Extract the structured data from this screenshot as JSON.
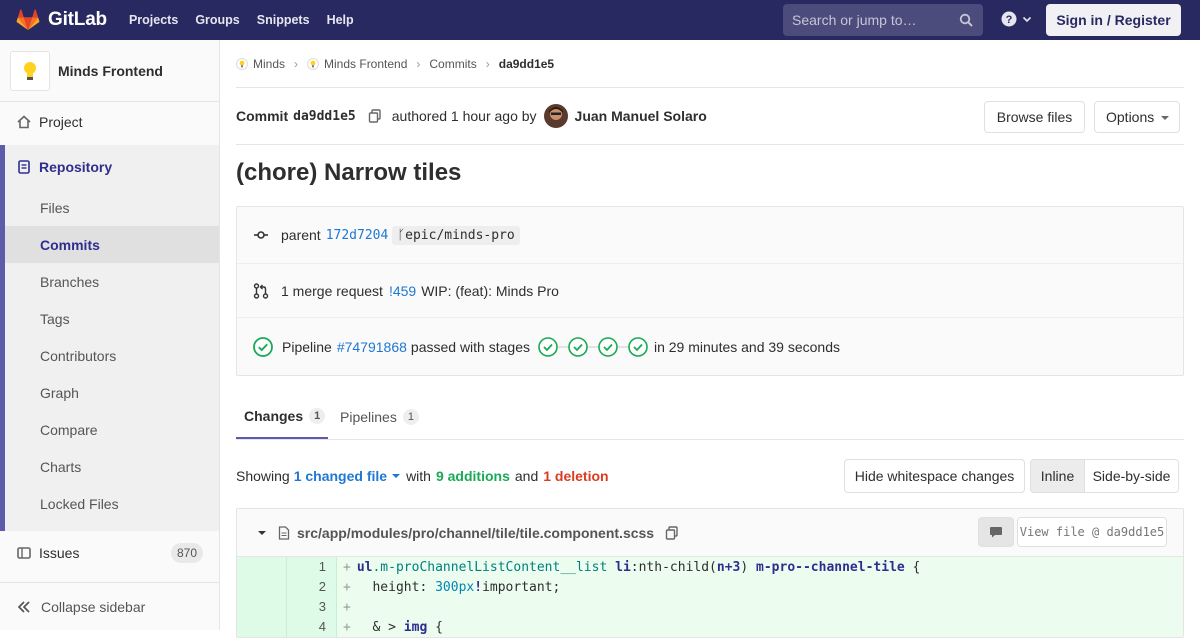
{
  "topnav": {
    "brand": "GitLab",
    "links": [
      "Projects",
      "Groups",
      "Snippets",
      "Help"
    ],
    "search_placeholder": "Search or jump to…",
    "signin_label": "Sign in / Register"
  },
  "sidebar": {
    "project_name": "Minds Frontend",
    "project_item": "Project",
    "repository_item": "Repository",
    "repo_items": [
      "Files",
      "Commits",
      "Branches",
      "Tags",
      "Contributors",
      "Graph",
      "Compare",
      "Charts",
      "Locked Files"
    ],
    "active_repo_item": "Commits",
    "issues_label": "Issues",
    "issues_count": "870",
    "collapse_label": "Collapse sidebar"
  },
  "breadcrumbs": [
    "Minds",
    "Minds Frontend",
    "Commits",
    "da9dd1e5"
  ],
  "commit": {
    "label": "Commit",
    "sha": "da9dd1e5",
    "authored": "authored 1 hour ago by",
    "author": "Juan Manuel Solaro",
    "browse_files": "Browse files",
    "options": "Options",
    "title": "(chore) Narrow tiles",
    "parent_label": "parent",
    "parent_sha": "172d7204",
    "branch": "epic/minds-pro",
    "merge_request_text": "1 merge request",
    "merge_request_id": "!459",
    "merge_request_title": "WIP: (feat): Minds Pro",
    "pipeline_label": "Pipeline",
    "pipeline_id": "#74791868",
    "pipeline_status": "passed with stages",
    "pipeline_duration": "in 29 minutes and 39 seconds"
  },
  "tabs": [
    {
      "label": "Changes",
      "count": "1"
    },
    {
      "label": "Pipelines",
      "count": "1"
    }
  ],
  "diffstats": {
    "showing": "Showing",
    "changed_files": "1 changed file",
    "with": "with",
    "additions": "9 additions",
    "and": "and",
    "deletions": "1 deletion",
    "hide_whitespace": "Hide whitespace changes",
    "inline": "Inline",
    "side_by_side": "Side-by-side"
  },
  "file": {
    "path": "src/app/modules/pro/channel/tile/tile.component.scss",
    "view_file": "View file @ da9dd1e5",
    "lines": [
      {
        "num": "1",
        "text": "ul.m-proChannelListContent__list li:nth-child(n+3) m-pro--channel-tile {"
      },
      {
        "num": "2",
        "text": "  height: 300px!important;"
      },
      {
        "num": "3",
        "text": ""
      },
      {
        "num": "4",
        "text": "  & > img {"
      }
    ]
  },
  "colors": {
    "nav": "#292961",
    "accent": "#5c5caa",
    "link": "#1f78d1",
    "success": "#1aaa55",
    "danger": "#db3b21"
  }
}
